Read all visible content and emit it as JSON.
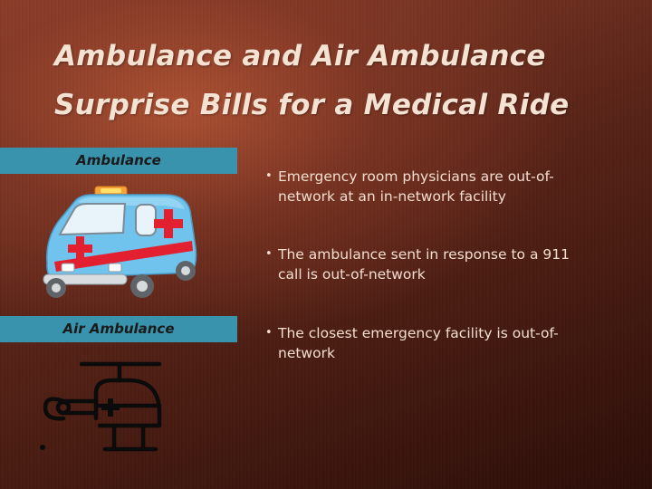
{
  "title": {
    "line1": "Ambulance and Air Ambulance",
    "line2": "Surprise Bills for a Medical Ride"
  },
  "sections": [
    {
      "label": "Ambulance",
      "icon": "ambulance-icon"
    },
    {
      "label": "Air Ambulance",
      "icon": "helicopter-icon"
    }
  ],
  "bullets": [
    {
      "marker": "•",
      "text": "Emergency room physicians are out-of-network at an in-network facility"
    },
    {
      "marker": "•",
      "text": "The ambulance sent in response to a 911 call is out-of-network"
    },
    {
      "marker": "•",
      "text": "The closest emergency facility is out-of-network"
    }
  ],
  "colors": {
    "band": "#3a93ad",
    "title_text": "#f4e3d3",
    "body_text": "#f3ded0",
    "ambulance_body": "#6fc3ec",
    "cross_red": "#e2202f"
  }
}
